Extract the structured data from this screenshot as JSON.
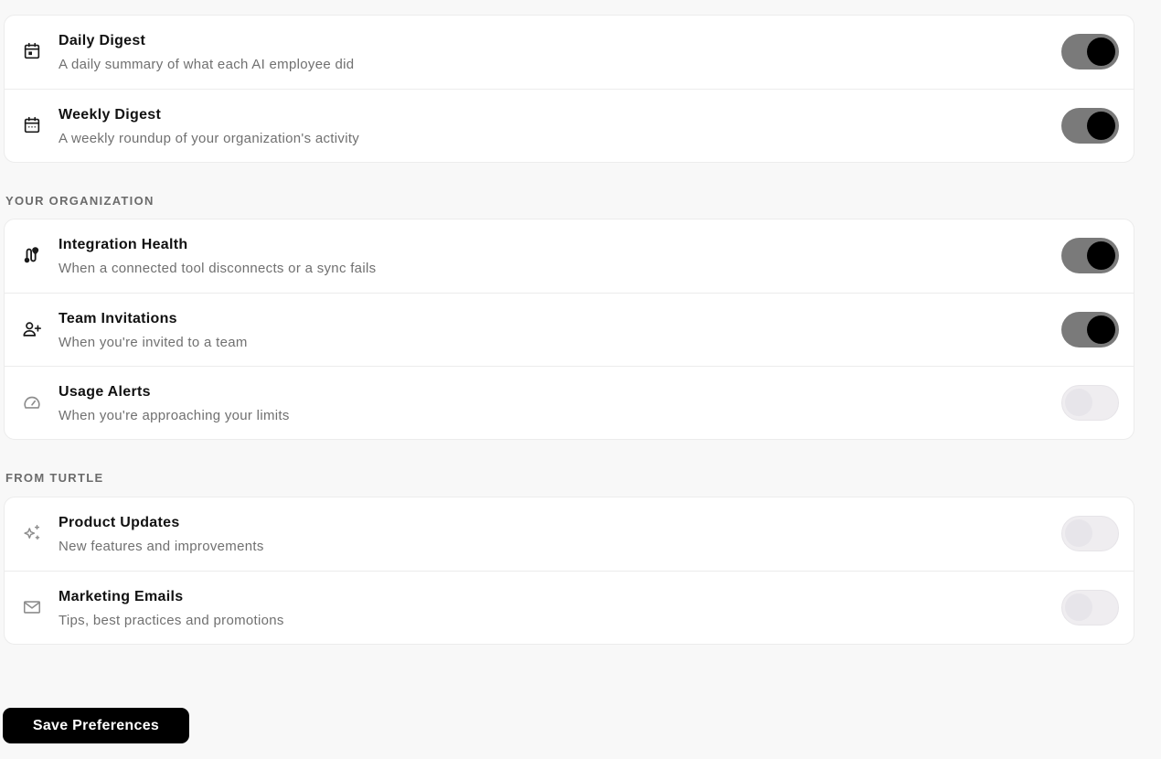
{
  "digests": [
    {
      "title": "Daily Digest",
      "description": "A daily summary of what each AI employee did",
      "icon": "calendar-icon",
      "enabled": true
    },
    {
      "title": "Weekly Digest",
      "description": "A weekly roundup of your organization's activity",
      "icon": "calendar-week-icon",
      "enabled": true
    }
  ],
  "organization": {
    "label": "YOUR ORGANIZATION",
    "items": [
      {
        "title": "Integration Health",
        "description": "When a connected tool disconnects or a sync fails",
        "icon": "route-icon",
        "enabled": true
      },
      {
        "title": "Team Invitations",
        "description": "When you're invited to a team",
        "icon": "user-plus-icon",
        "enabled": true
      },
      {
        "title": "Usage Alerts",
        "description": "When you're approaching your limits",
        "icon": "gauge-icon",
        "enabled": false
      }
    ]
  },
  "turtle": {
    "label": "FROM TURTLE",
    "items": [
      {
        "title": "Product Updates",
        "description": "New features and improvements",
        "icon": "sparkles-icon",
        "enabled": false
      },
      {
        "title": "Marketing Emails",
        "description": "Tips, best practices and promotions",
        "icon": "mail-icon",
        "enabled": false
      }
    ]
  },
  "actions": {
    "save_label": "Save Preferences"
  },
  "colors": {
    "toggle_on_track": "#7a7a7a",
    "toggle_on_knob": "#000000",
    "toggle_off_track": "#efedf0",
    "button_bg": "#000000"
  }
}
